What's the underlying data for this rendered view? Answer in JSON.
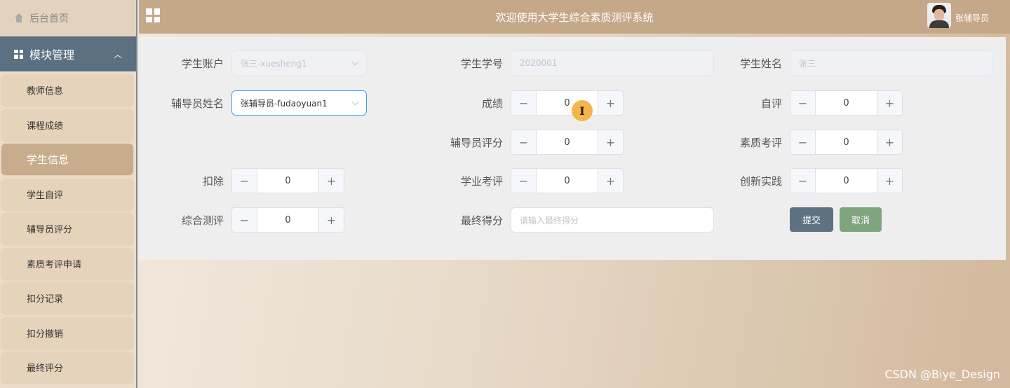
{
  "sidebar": {
    "home_label": "后台首页",
    "module_label": "模块管理",
    "items": [
      {
        "label": "教师信息"
      },
      {
        "label": "课程成绩"
      },
      {
        "label": "学生信息"
      },
      {
        "label": "学生自评"
      },
      {
        "label": "辅导员评分"
      },
      {
        "label": "素质考评申请"
      },
      {
        "label": "扣分记录"
      },
      {
        "label": "扣分撤销"
      },
      {
        "label": "最终评分"
      }
    ]
  },
  "header": {
    "title": "欢迎使用大学生综合素质测评系统",
    "username": "张辅导员"
  },
  "form": {
    "student_account": {
      "label": "学生账户",
      "value": "张三-xuesheng1"
    },
    "student_no": {
      "label": "学生学号",
      "value": "2020001"
    },
    "student_name": {
      "label": "学生姓名",
      "value": "张三"
    },
    "counselor_name": {
      "label": "辅导员姓名",
      "value": "张辅导员-fudaoyuan1"
    },
    "score": {
      "label": "成绩",
      "value": "0"
    },
    "self_eval": {
      "label": "自评",
      "value": "0"
    },
    "counselor_score": {
      "label": "辅导员评分",
      "value": "0"
    },
    "quality_eval": {
      "label": "素质考评",
      "value": "0"
    },
    "deduction": {
      "label": "扣除",
      "value": "0"
    },
    "academic_eval": {
      "label": "学业考评",
      "value": "0"
    },
    "innovation": {
      "label": "创新实践",
      "value": "0"
    },
    "comprehensive": {
      "label": "综合测评",
      "value": "0"
    },
    "final_score": {
      "label": "最终得分",
      "placeholder": "请输入最终得分"
    },
    "submit_label": "提交",
    "cancel_label": "取消"
  },
  "watermark": "CSDN @Biye_Design"
}
